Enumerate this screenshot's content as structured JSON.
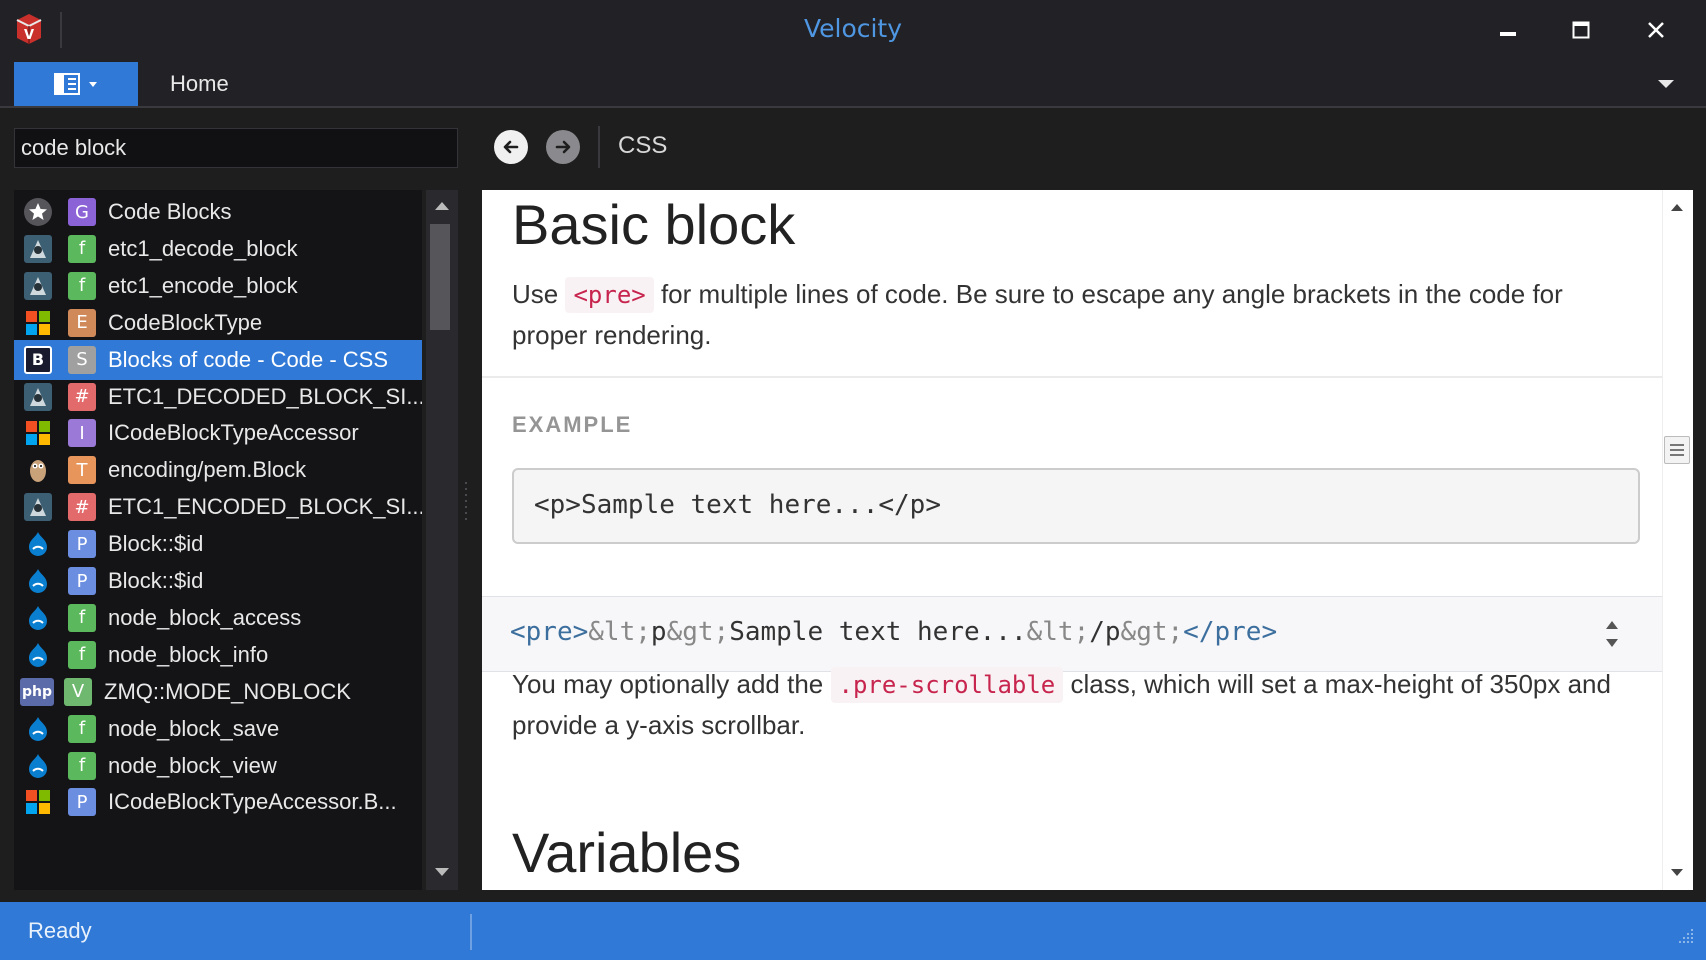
{
  "window": {
    "title": "Velocity"
  },
  "tabbar": {
    "home_tab": "Home"
  },
  "search": {
    "value": "code block"
  },
  "nav": {
    "doc_title": "CSS"
  },
  "results": [
    {
      "docset": "star",
      "kind": "G",
      "label": "Code Blocks"
    },
    {
      "docset": "android",
      "kind": "f",
      "label": "etc1_decode_block"
    },
    {
      "docset": "android",
      "kind": "f",
      "label": "etc1_encode_block"
    },
    {
      "docset": "windows",
      "kind": "E",
      "label": "CodeBlockType"
    },
    {
      "docset": "bootstrap",
      "kind": "S",
      "label": "Blocks of code - Code - CSS",
      "selected": true
    },
    {
      "docset": "android",
      "kind": "#",
      "label": "ETC1_DECODED_BLOCK_SI..."
    },
    {
      "docset": "windows",
      "kind": "I",
      "label": "ICodeBlockTypeAccessor"
    },
    {
      "docset": "go",
      "kind": "T",
      "label": "encoding/pem.Block"
    },
    {
      "docset": "android",
      "kind": "#",
      "label": "ETC1_ENCODED_BLOCK_SI..."
    },
    {
      "docset": "drupal",
      "kind": "P",
      "label": "Block::$id"
    },
    {
      "docset": "drupal",
      "kind": "P",
      "label": "Block::$id"
    },
    {
      "docset": "drupal",
      "kind": "f",
      "label": "node_block_access"
    },
    {
      "docset": "drupal",
      "kind": "f",
      "label": "node_block_info"
    },
    {
      "docset": "php",
      "kind": "V",
      "label": "ZMQ::MODE_NOBLOCK"
    },
    {
      "docset": "drupal",
      "kind": "f",
      "label": "node_block_save"
    },
    {
      "docset": "drupal",
      "kind": "f",
      "label": "node_block_view"
    },
    {
      "docset": "windows",
      "kind": "P",
      "label": "ICodeBlockTypeAccessor.B..."
    }
  ],
  "kind_colors": {
    "G": "#8b63d6",
    "f": "#5cb85c",
    "E": "#d08a5a",
    "S": "#a0a0a0",
    "#": "#e36a6a",
    "I": "#9a7ad6",
    "T": "#e8955b",
    "P": "#6b8ee0",
    "V": "#6fb86f"
  },
  "docset_icons": {
    "bootstrap_letter": "B",
    "php_text": "php"
  },
  "content": {
    "heading": "Basic block",
    "para1_before": "Use ",
    "para1_code": "<pre>",
    "para1_after": " for multiple lines of code. Be sure to escape any angle brackets in the code for proper rendering.",
    "example_label": "EXAMPLE",
    "example_pre": "<p>Sample text here...</p>",
    "code_parts": [
      {
        "t": "<pre>",
        "c": "tag"
      },
      {
        "t": "&lt;",
        "c": "ent"
      },
      {
        "t": "p",
        "c": "txt"
      },
      {
        "t": "&gt;",
        "c": "ent"
      },
      {
        "t": "Sample text here...",
        "c": "txt"
      },
      {
        "t": "&lt;",
        "c": "ent"
      },
      {
        "t": "/p",
        "c": "txt"
      },
      {
        "t": "&gt;",
        "c": "ent"
      },
      {
        "t": "</pre>",
        "c": "tag"
      }
    ],
    "para2_before": "You may optionally add the ",
    "para2_code": ".pre-scrollable",
    "para2_after": " class, which will set a max-height of 350px and provide a y-axis scrollbar.",
    "heading2": "Variables"
  },
  "status": {
    "text": "Ready"
  },
  "colors": {
    "accent": "#3079d6",
    "title": "#4f97e3",
    "code_red": "#c7254e"
  }
}
